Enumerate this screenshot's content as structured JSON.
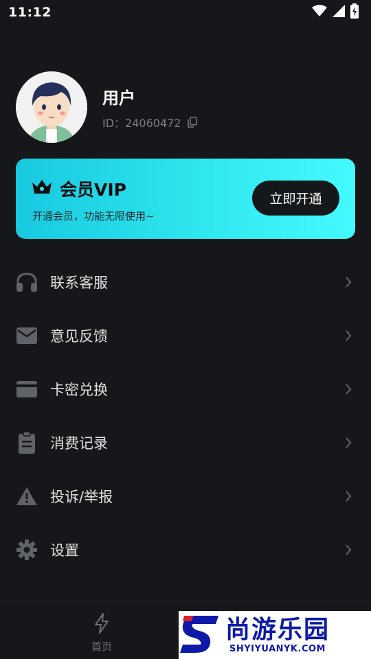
{
  "status_bar": {
    "time": "11:12",
    "icons": [
      "wifi-icon",
      "signal-icon",
      "battery-charging-icon"
    ]
  },
  "profile": {
    "username": "用户",
    "id_text": "ID：24060472",
    "avatar": "avatar-illustration"
  },
  "vip": {
    "title": "会员VIP",
    "subtitle": "开通会员，功能无限使用~",
    "button_label": "立即开通",
    "icon": "crown-icon",
    "gradient": [
      "#18c9e0",
      "#43fbff"
    ]
  },
  "menu": {
    "items": [
      {
        "label": "联系客服",
        "icon": "headphones-icon"
      },
      {
        "label": "意见反馈",
        "icon": "mail-icon"
      },
      {
        "label": "卡密兑换",
        "icon": "card-icon"
      },
      {
        "label": "消费记录",
        "icon": "clipboard-icon"
      },
      {
        "label": "投诉/举报",
        "icon": "warning-icon"
      },
      {
        "label": "设置",
        "icon": "gear-icon"
      }
    ]
  },
  "bottom_nav": {
    "home_label": "首页",
    "home_icon": "lightning-icon"
  },
  "watermark": {
    "cn": "尚游乐园",
    "en": "SHYIYUANYK.COM",
    "color": "#0d1aa8"
  },
  "colors": {
    "background": "#16171a",
    "accent": "#2fe7ee"
  }
}
